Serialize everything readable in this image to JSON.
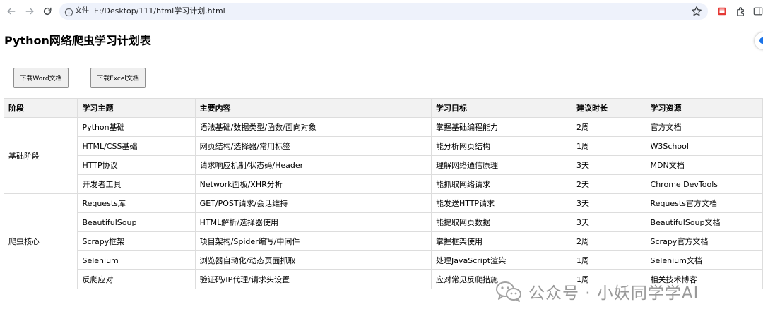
{
  "browser": {
    "scheme_label": "文件",
    "url": "E:/Desktop/111/html学习计划.html",
    "icons": {
      "back": "back-arrow-icon",
      "forward": "forward-arrow-icon",
      "reload": "reload-icon",
      "info": "info-icon",
      "bookmark": "star-icon",
      "extension": "extension-icon",
      "puzzle": "puzzle-icon",
      "side_panel": "side-panel-icon"
    },
    "accent": "#eef2fb"
  },
  "page": {
    "title": "Python网络爬虫学习计划表",
    "buttons": {
      "word": "下载Word文档",
      "excel": "下载Excel文档"
    }
  },
  "table": {
    "headers": [
      "阶段",
      "学习主题",
      "主要内容",
      "学习目标",
      "建议时长",
      "学习资源"
    ],
    "groups": [
      {
        "stage": "基础阶段",
        "rows": [
          [
            "Python基础",
            "语法基础/数据类型/函数/面向对象",
            "掌握基础编程能力",
            "2周",
            "官方文档"
          ],
          [
            "HTML/CSS基础",
            "网页结构/选择器/常用标签",
            "能分析网页结构",
            "1周",
            "W3School"
          ],
          [
            "HTTP协议",
            "请求响应机制/状态码/Header",
            "理解网络通信原理",
            "3天",
            "MDN文档"
          ],
          [
            "开发者工具",
            "Network面板/XHR分析",
            "能抓取网络请求",
            "2天",
            "Chrome DevTools"
          ]
        ]
      },
      {
        "stage": "爬虫核心",
        "rows": [
          [
            "Requests库",
            "GET/POST请求/会话维持",
            "能发送HTTP请求",
            "3天",
            "Requests官方文档"
          ],
          [
            "BeautifulSoup",
            "HTML解析/选择器使用",
            "能提取网页数据",
            "3天",
            "BeautifulSoup文档"
          ],
          [
            "Scrapy框架",
            "项目架构/Spider编写/中间件",
            "掌握框架使用",
            "2周",
            "Scrapy官方文档"
          ],
          [
            "Selenium",
            "浏览器自动化/动态页面抓取",
            "处理JavaScript渲染",
            "1周",
            "Selenium文档"
          ],
          [
            "反爬应对",
            "验证码/IP代理/请求头设置",
            "应对常见反爬措施",
            "1周",
            "相关技术博客"
          ]
        ]
      }
    ]
  },
  "watermark": {
    "text": "公众号 · 小妖同学学AI",
    "icon": "wechat-logo-icon"
  }
}
